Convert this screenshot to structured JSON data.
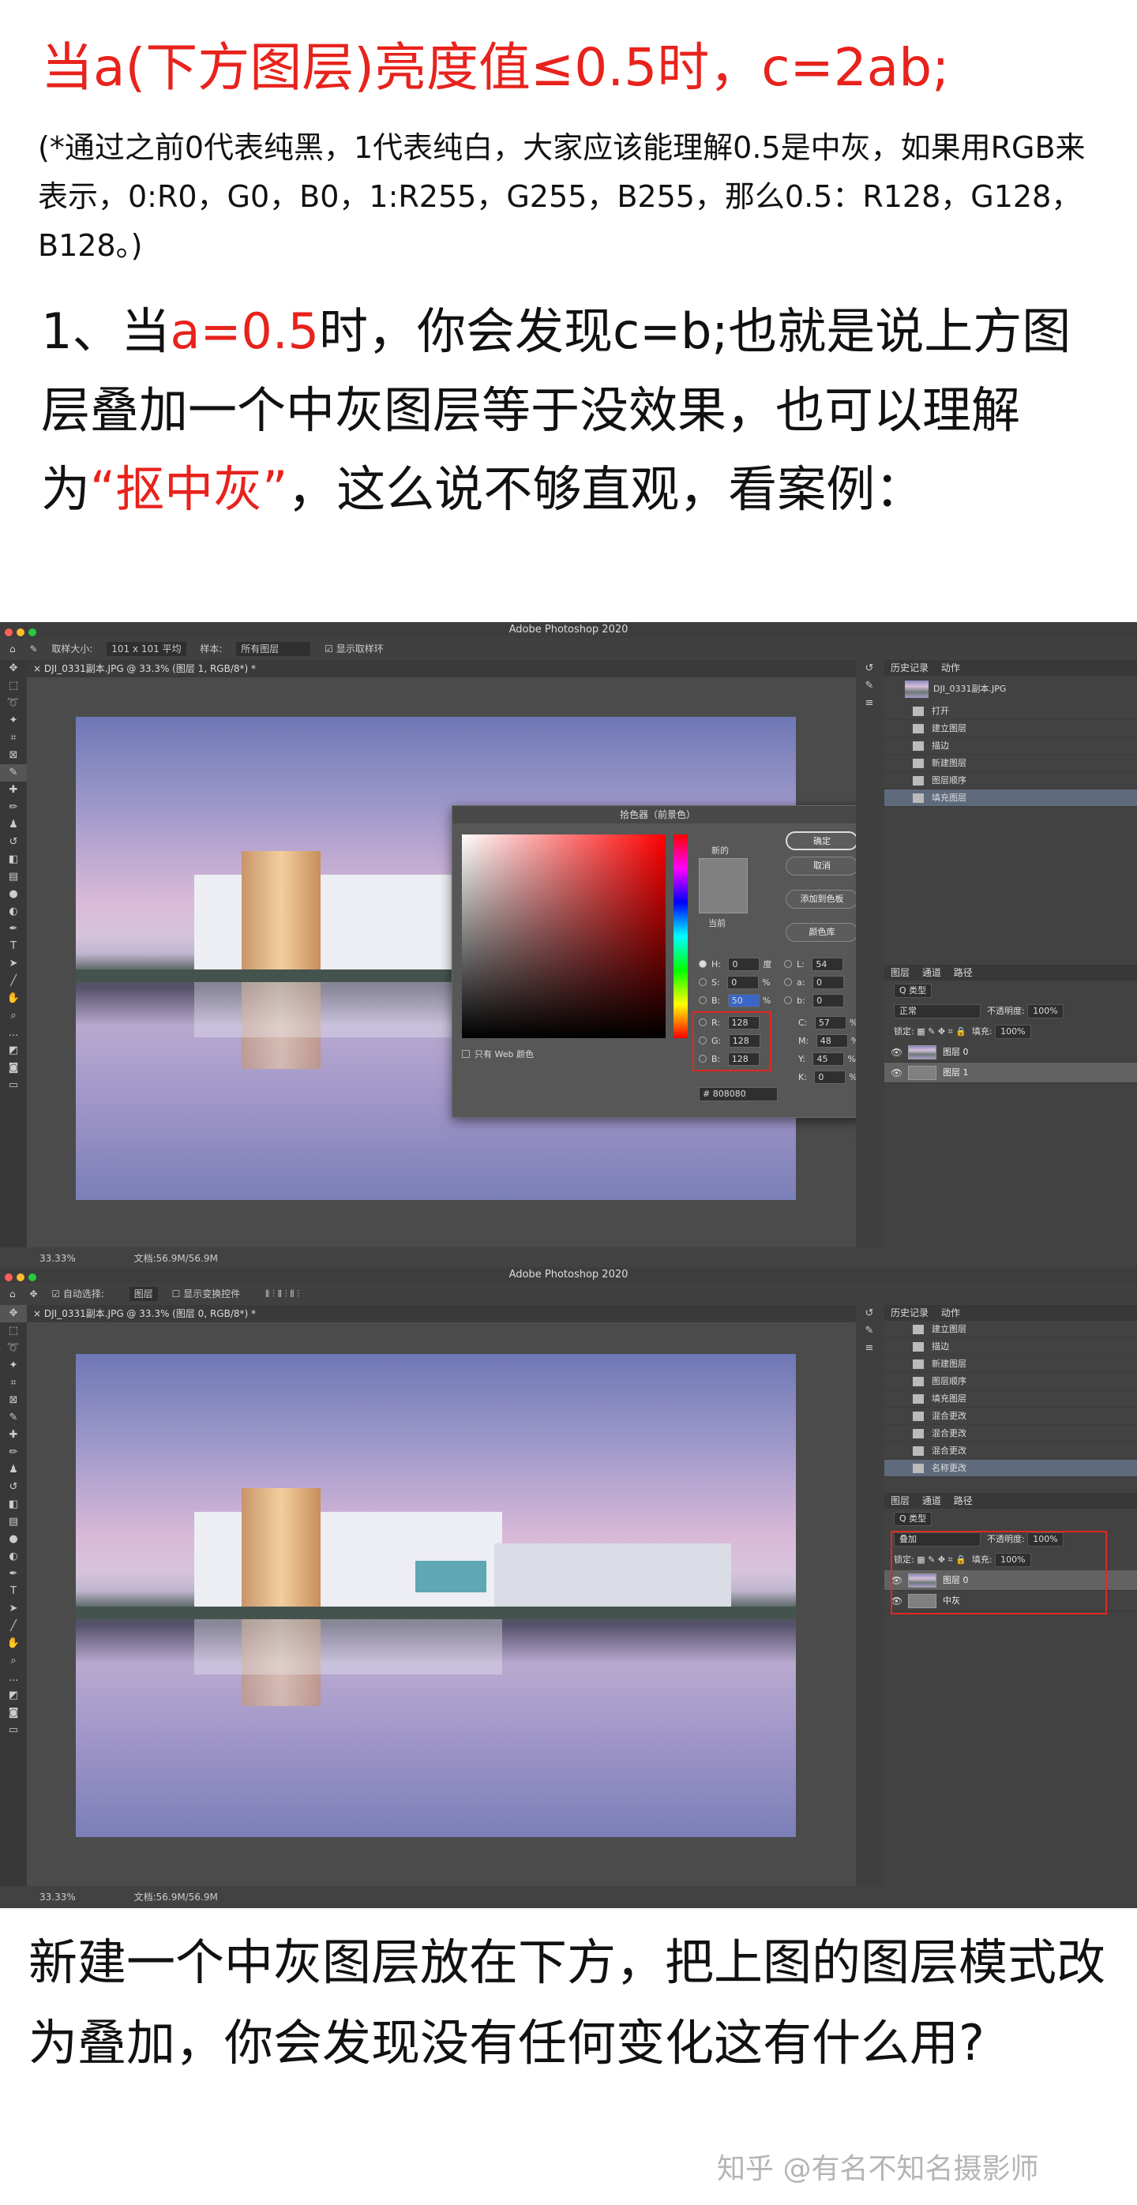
{
  "heading": "当a(下方图层)亮度值≤0.5时，c=2ab;",
  "note": "(*通过之前0代表纯黑，1代表纯白，大家应该能理解0.5是中灰，如果用RGB来表示，0:R0，G0，B0，1:R255，G255，B255，那么0.5：R128，G128，B128。)",
  "para": {
    "p1": "1、当",
    "a_eq": "a=0.5",
    "p2": "时，你会发现c=b;也就是说上方图层叠加一个中灰图层等于没效果，也可以理解为",
    "quote": "“抠中灰”",
    "p3": "，这么说不够直观，看案例："
  },
  "ps1": {
    "app_title": "Adobe Photoshop 2020",
    "options": [
      "取样大小:",
      "101 x 101 平均",
      "样本:",
      "所有图层",
      "显示取样环"
    ],
    "doc_tab": "DJI_0331副本.JPG @ 33.3% (图层 1, RGB/8*) *",
    "zoom": "33.33%",
    "doc_size": "文档:56.9M/56.9M",
    "history_tabs": [
      "历史记录",
      "动作"
    ],
    "history_snapshot": "DJI_0331副本.JPG",
    "history": [
      "打开",
      "建立图层",
      "描边",
      "新建图层",
      "图层顺序",
      "填充图层"
    ],
    "layer_tabs": [
      "图层",
      "通道",
      "路径"
    ],
    "kind": "Q 类型",
    "blend": "正常",
    "opacity_label": "不透明度:",
    "opacity": "100%",
    "lock_label": "锁定:",
    "fill_label": "填充:",
    "fill": "100%",
    "layers": [
      "图层 0",
      "图层 1"
    ],
    "picker": {
      "title": "拾色器（前景色）",
      "new_label": "新的",
      "current_label": "当前",
      "ok": "确定",
      "cancel": "取消",
      "add_swatch": "添加到色板",
      "libraries": "颜色库",
      "web_only": "只有 Web 颜色",
      "H": "0",
      "H_unit": "度",
      "S": "0",
      "S_unit": "%",
      "B": "50",
      "B_unit": "%",
      "R": "128",
      "G": "128",
      "Bv": "128",
      "L": "54",
      "a": "0",
      "b": "0",
      "C": "57",
      "M": "48",
      "Y": "45",
      "K": "0",
      "pct": "%",
      "hex": "808080"
    }
  },
  "ps2": {
    "app_title": "Adobe Photoshop 2020",
    "options": [
      "自动选择:",
      "图层",
      "显示变换控件"
    ],
    "doc_tab": "DJI_0331副本.JPG @ 33.3% (图层 0, RGB/8*) *",
    "zoom": "33.33%",
    "doc_size": "文档:56.9M/56.9M",
    "history_tabs": [
      "历史记录",
      "动作"
    ],
    "history": [
      "建立图层",
      "描边",
      "新建图层",
      "图层顺序",
      "填充图层",
      "混合更改",
      "混合更改",
      "混合更改",
      "名称更改"
    ],
    "layer_tabs": [
      "图层",
      "通道",
      "路径"
    ],
    "kind": "Q 类型",
    "blend": "叠加",
    "opacity_label": "不透明度:",
    "opacity": "100%",
    "lock_label": "锁定:",
    "fill_label": "填充:",
    "fill": "100%",
    "layers": [
      "图层 0",
      "中灰"
    ]
  },
  "bottom_text": "新建一个中灰图层放在下方，把上图的图层模式改为叠加，你会发现没有任何变化这有什么用?",
  "watermark": "知乎 @有名不知名摄影师"
}
